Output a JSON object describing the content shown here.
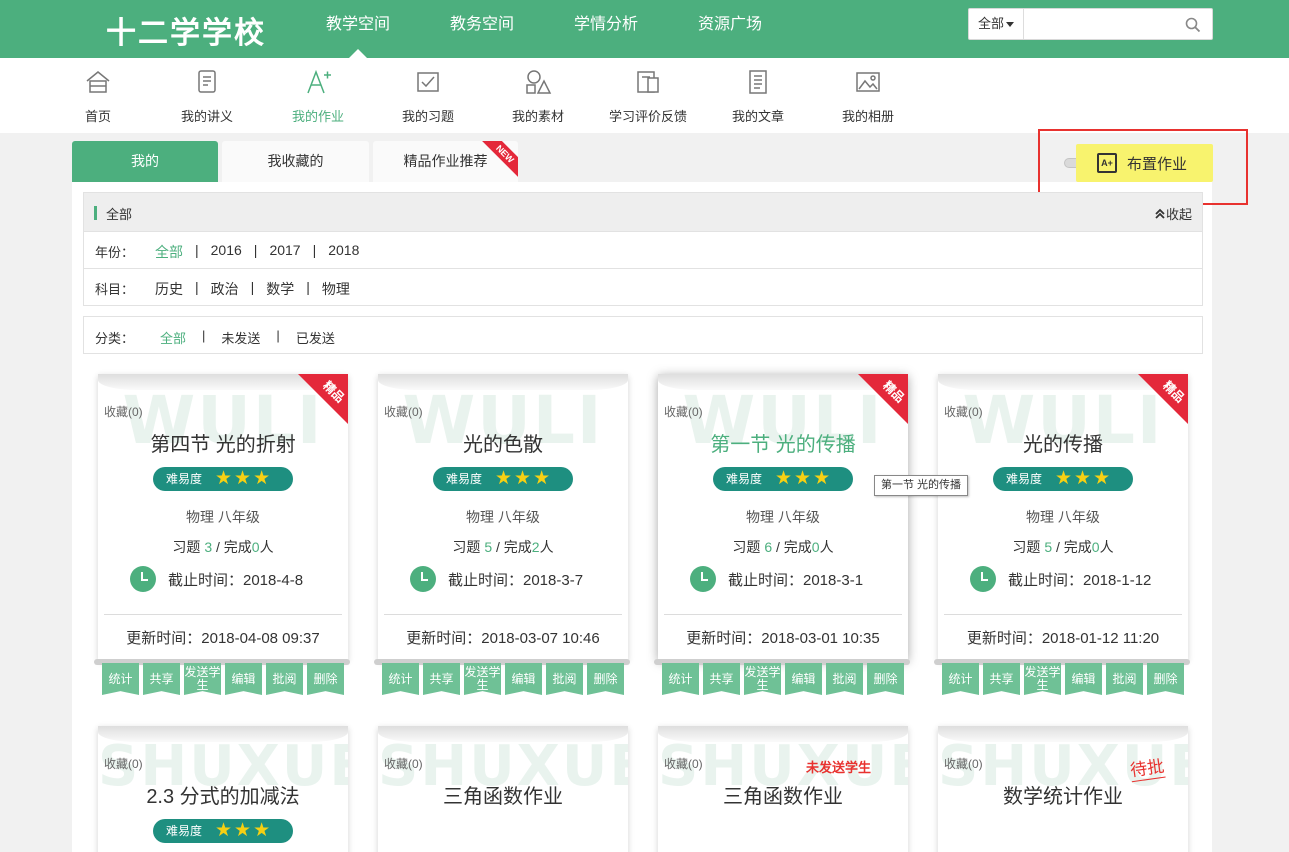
{
  "school_name": "十二学学校",
  "top_nav": [
    "教学空间",
    "教务空间",
    "学情分析",
    "资源广场"
  ],
  "search": {
    "scope": "全部",
    "placeholder": ""
  },
  "sub_nav": [
    "首页",
    "我的讲义",
    "我的作业",
    "我的习题",
    "我的素材",
    "学习评价反馈",
    "我的文章",
    "我的相册"
  ],
  "tabs": [
    "我的",
    "我收藏的",
    "精品作业推荐"
  ],
  "new_badge": "NEW",
  "assign_button": {
    "icon": "A+",
    "label": "布置作业"
  },
  "filter": {
    "title": "全部",
    "collapse": "收起",
    "year_label": "年份：",
    "years": [
      "全部",
      "2016",
      "2017",
      "2018"
    ],
    "subject_label": "科目：",
    "subjects": [
      "历史",
      "政治",
      "数学",
      "物理"
    ]
  },
  "category": {
    "label": "分类：",
    "options": [
      "全部",
      "未发送",
      "已发送"
    ]
  },
  "cards": [
    {
      "fav": "收藏(0)",
      "title": "第四节 光的折射",
      "watermark": "WULI",
      "difficulty": "难易度",
      "stars": "★★★",
      "subject": "物理  八年级",
      "q_label": "习题",
      "q": "3",
      "sep": "/",
      "done_label": "完成",
      "done": "0",
      "done_unit": "人",
      "deadline": "截止时间：2018-4-8",
      "updated": "更新时间：2018-04-08 09:37",
      "ribbon": "精品"
    },
    {
      "fav": "收藏(0)",
      "title": "光的色散",
      "watermark": "WULI",
      "difficulty": "难易度",
      "stars": "★★★",
      "subject": "物理  八年级",
      "q_label": "习题",
      "q": "5",
      "sep": "/",
      "done_label": "完成",
      "done": "2",
      "done_unit": "人",
      "deadline": "截止时间：2018-3-7",
      "updated": "更新时间：2018-03-07 10:46",
      "ribbon": ""
    },
    {
      "fav": "收藏(0)",
      "title": "第一节 光的传播",
      "watermark": "WULI",
      "difficulty": "难易度",
      "stars": "★★★",
      "subject": "物理  八年级",
      "q_label": "习题",
      "q": "6",
      "sep": "/",
      "done_label": "完成",
      "done": "0",
      "done_unit": "人",
      "deadline": "截止时间：2018-3-1",
      "updated": "更新时间：2018-03-01 10:35",
      "ribbon": "精品"
    },
    {
      "fav": "收藏(0)",
      "title": "光的传播",
      "watermark": "WULI",
      "difficulty": "难易度",
      "stars": "★★★",
      "subject": "物理  八年级",
      "q_label": "习题",
      "q": "5",
      "sep": "/",
      "done_label": "完成",
      "done": "0",
      "done_unit": "人",
      "deadline": "截止时间：2018-1-12",
      "updated": "更新时间：2018-01-12 11:20",
      "ribbon": "精品"
    },
    {
      "fav": "收藏(0)",
      "title": "2.3 分式的加减法",
      "watermark": "SHUXUE",
      "difficulty": "难易度",
      "stars": "★★★"
    },
    {
      "fav": "收藏(0)",
      "title": "三角函数作业",
      "watermark": "SHUXUE"
    },
    {
      "fav": "收藏(0)",
      "title": "三角函数作业",
      "watermark": "SHUXUE",
      "stamp": "未发送学生"
    },
    {
      "fav": "收藏(0)",
      "title": "数学统计作业",
      "watermark": "SHUXUE",
      "stamp": "待批"
    }
  ],
  "card_actions": [
    "统计",
    "共享",
    "发送学生",
    "编辑",
    "批阅",
    "删除"
  ],
  "tooltip": "第一节 光的传播",
  "colors": {
    "primary": "#4caf7e",
    "highlight": "#f8f36e",
    "alert": "#e8322f"
  }
}
